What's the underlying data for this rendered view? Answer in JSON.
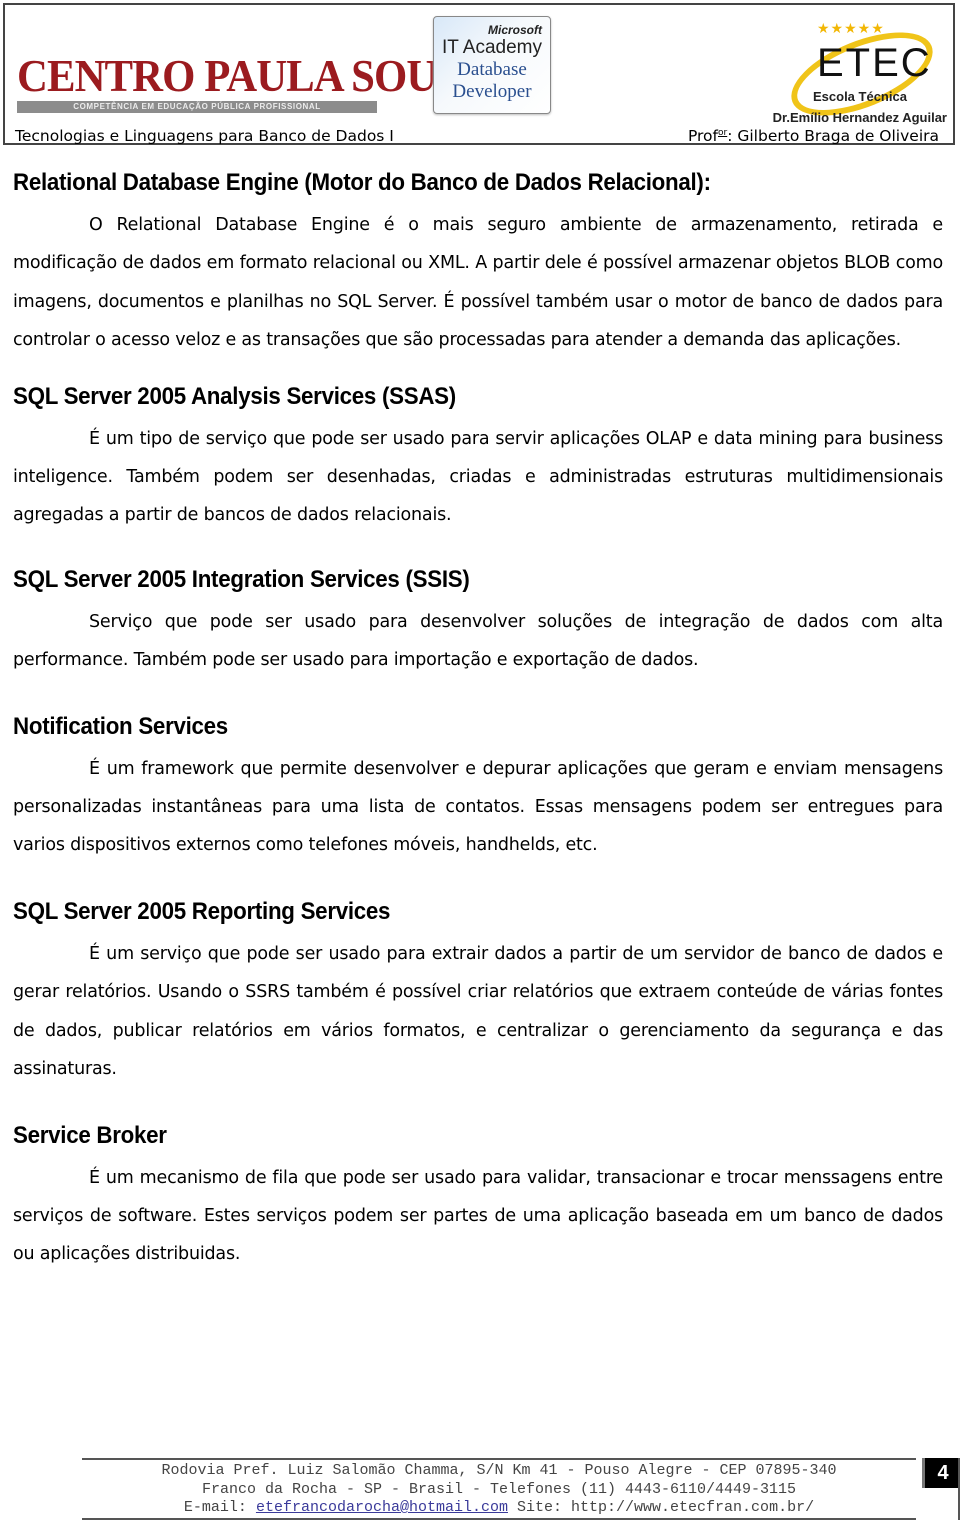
{
  "header": {
    "left_logo": {
      "title": "CENTRO PAULA SOUZA",
      "tagline": "COMPETÊNCIA EM EDUCAÇÃO PÚBLICA PROFISSIONAL"
    },
    "center_logo": {
      "brand": "Microsoft",
      "program": "IT Academy",
      "line1": "Database",
      "line2": "Developer"
    },
    "right_logo": {
      "stars": "★★★★★",
      "name": "ETEC",
      "subtitle": "Escola Técnica",
      "school": "Dr.Emílio Hernandez Aguilar"
    },
    "course": "Tecnologias e Linguagens para Banco de Dados I",
    "prof_prefix": "Prof",
    "prof_sup": "or",
    "prof_name": ": Gilberto Braga de Oliveira"
  },
  "sections": [
    {
      "heading": "Relational Database Engine (Motor do Banco de Dados Relacional):",
      "body": "O Relational Database Engine é o mais seguro ambiente de armazenamento, retirada e modificação de dados em formato relacional ou XML. A partir dele é possível armazenar objetos BLOB como imagens, documentos e planilhas no SQL Server. É possível também usar o motor de banco de dados para controlar o acesso veloz e as transações que são processadas para atender a demanda das aplicações."
    },
    {
      "heading": "SQL Server 2005 Analysis Services (SSAS)",
      "body": "É um tipo de serviço que pode ser usado para servir aplicações OLAP e data mining para business inteligence. Também podem ser desenhadas, criadas e administradas estruturas multidimensionais agregadas a partir de bancos de dados relacionais."
    },
    {
      "heading": "SQL Server 2005 Integration Services (SSIS)",
      "body": "Serviço que pode ser usado para desenvolver soluções de integração de dados com alta performance. Também pode ser usado para importação e exportação de dados."
    },
    {
      "heading": "Notification Services",
      "body": "É um framework que permite desenvolver e depurar aplicações que geram e enviam mensagens personalizadas instantâneas para uma lista de contatos. Essas mensagens podem ser entregues para varios dispositivos externos como telefones móveis, handhelds, etc."
    },
    {
      "heading": "SQL Server 2005 Reporting Services",
      "body": "É um serviço que pode ser usado para extrair dados a partir de um servidor de banco de dados e gerar relatórios. Usando o SSRS também é possível criar relatórios que extraem conteúde de várias fontes de dados, publicar relatórios em vários formatos, e centralizar o gerenciamento da segurança e das assinaturas."
    },
    {
      "heading": "Service Broker",
      "body": "É um mecanismo de fila que pode ser usado para validar, transacionar e trocar menssagens entre serviços de software. Estes serviços podem ser partes de uma aplicação baseada em um banco de dados ou aplicações distribuidas."
    }
  ],
  "footer": {
    "address": "Rodovia Pref. Luiz Salomão Chamma, S/N Km 41 - Pouso Alegre - CEP 07895-340",
    "city_phone": "Franco da Rocha - SP - Brasil - Telefones (11) 4443-6110/4449-3115",
    "email_label": "E-mail:",
    "email": "etefrancodarocha@hotmail.com",
    "site_label": "Site:",
    "site": "http://www.etecfran.com.br/",
    "page_number": "4"
  }
}
